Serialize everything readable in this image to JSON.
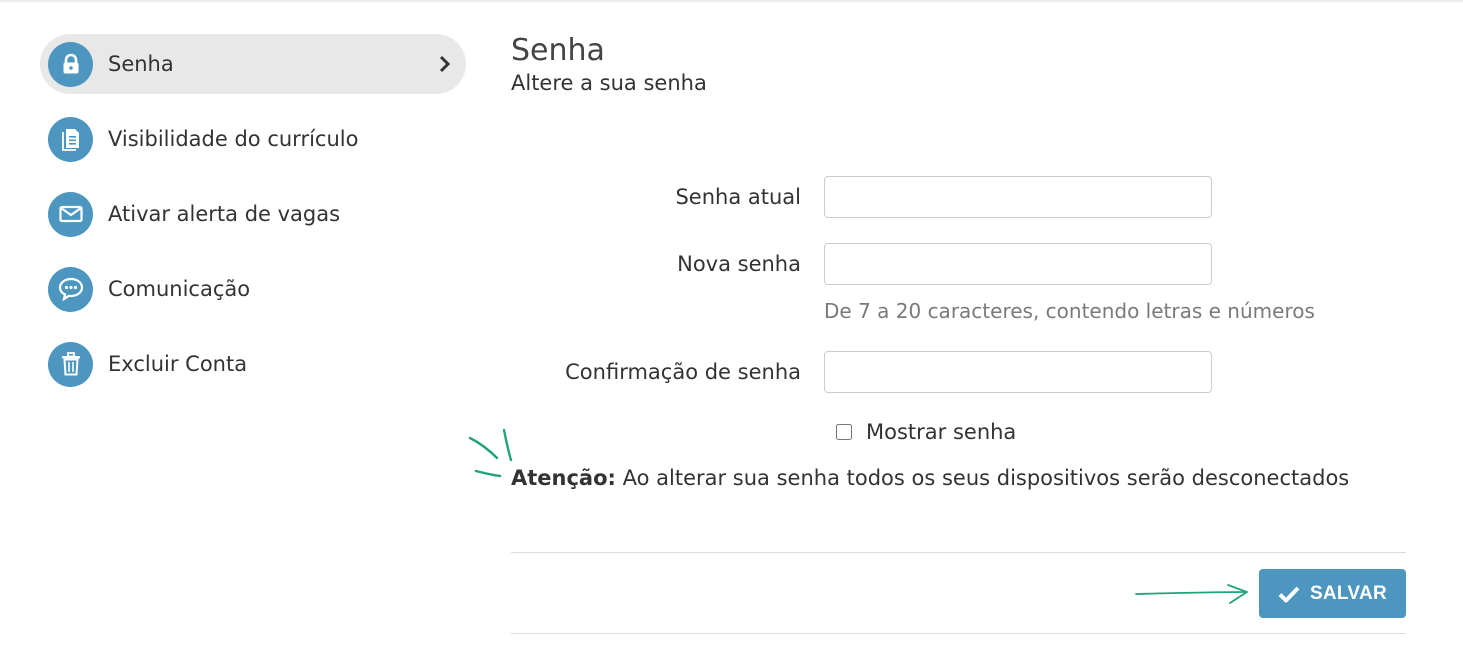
{
  "sidebar": {
    "items": [
      {
        "label": "Senha",
        "icon": "lock-icon",
        "active": true
      },
      {
        "label": "Visibilidade do currículo",
        "icon": "document-icon"
      },
      {
        "label": "Ativar alerta de vagas",
        "icon": "envelope-icon"
      },
      {
        "label": "Comunicação",
        "icon": "chat-bubble-icon"
      },
      {
        "label": "Excluir Conta",
        "icon": "trash-icon"
      }
    ]
  },
  "main": {
    "title": "Senha",
    "subtitle": "Altere a sua senha",
    "fields": {
      "current": {
        "label": "Senha atual",
        "value": ""
      },
      "new": {
        "label": "Nova senha",
        "value": "",
        "hint": "De 7 a 20 caracteres, contendo letras e números"
      },
      "confirm": {
        "label": "Confirmação de senha",
        "value": ""
      }
    },
    "show_password": {
      "label": "Mostrar senha",
      "checked": false
    },
    "warning": {
      "strong": "Atenção:",
      "text": " Ao alterar sua senha todos os seus dispositivos serão desconectados"
    },
    "save_label": "SALVAR"
  },
  "colors": {
    "accent": "#4c96bf",
    "annotation": "#1fa37a"
  }
}
